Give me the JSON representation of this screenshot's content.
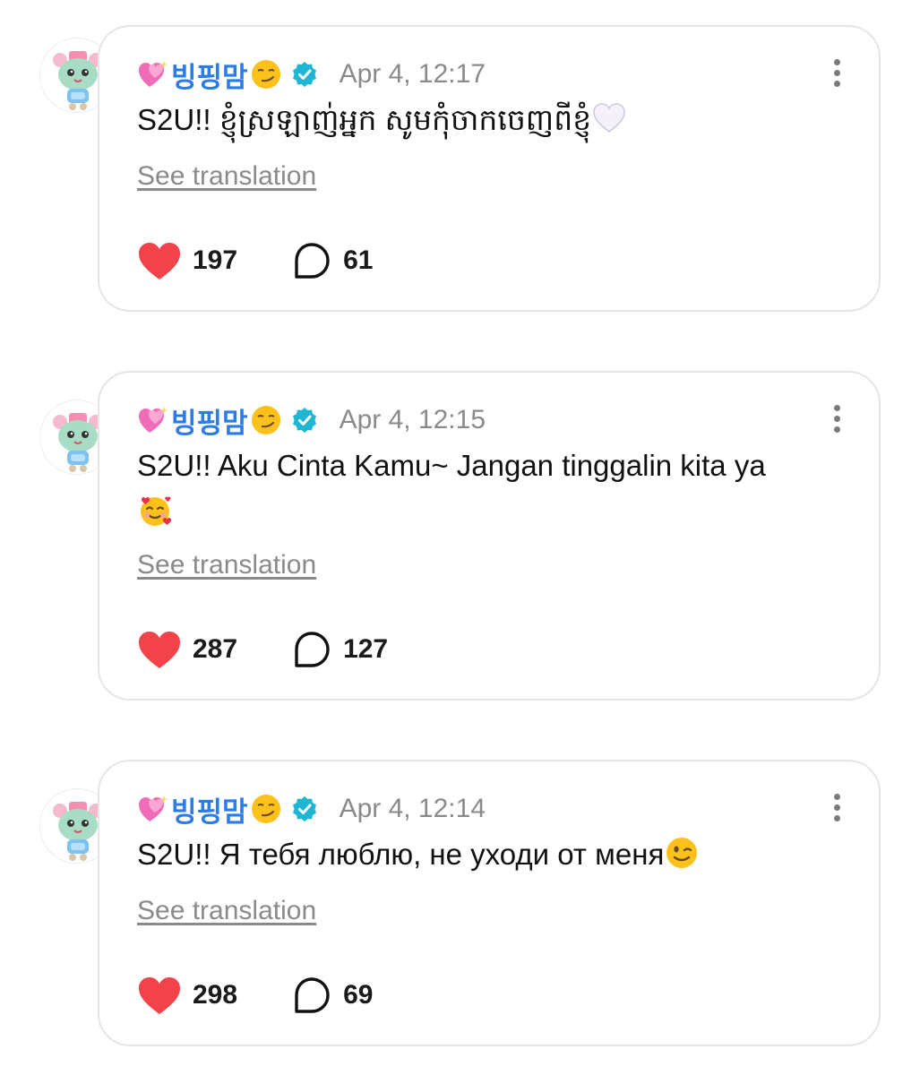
{
  "posts": [
    {
      "username": "빙핑맘",
      "timestamp": "Apr 4, 12:17",
      "message": "S2U!! ខ្ញុំស្រឡាញ់អ្នក សូមកុំចាកចេញពីខ្ញុំ",
      "message_emoji": "white-heart-emoji",
      "see_translation": "See translation",
      "likes": "197",
      "comments": "61"
    },
    {
      "username": "빙핑맘",
      "timestamp": "Apr 4, 12:15",
      "message": "S2U!! Aku Cinta Kamu~ Jangan tinggalin kita ya",
      "message_emoji": "smiling-face-with-hearts-emoji",
      "see_translation": "See translation",
      "likes": "287",
      "comments": "127"
    },
    {
      "username": "빙핑맘",
      "timestamp": "Apr 4, 12:14",
      "message": "S2U!! Я тебя люблю, не уходи от меня",
      "message_emoji": "winking-face-emoji",
      "see_translation": "See translation",
      "likes": "298",
      "comments": "69"
    }
  ],
  "colors": {
    "username": "#2b7be8",
    "verified_badge": "#1fb6d4",
    "like_heart": "#f2434a",
    "muted_text": "#8a8a8a",
    "card_border": "#e6e6e6"
  },
  "icons": {
    "name_prefix": "sparkling-heart-icon",
    "name_suffix": "smirking-face-icon",
    "verified": "verified-badge-icon",
    "more": "more-vertical-icon",
    "like": "heart-icon",
    "comment": "comment-bubble-icon"
  }
}
